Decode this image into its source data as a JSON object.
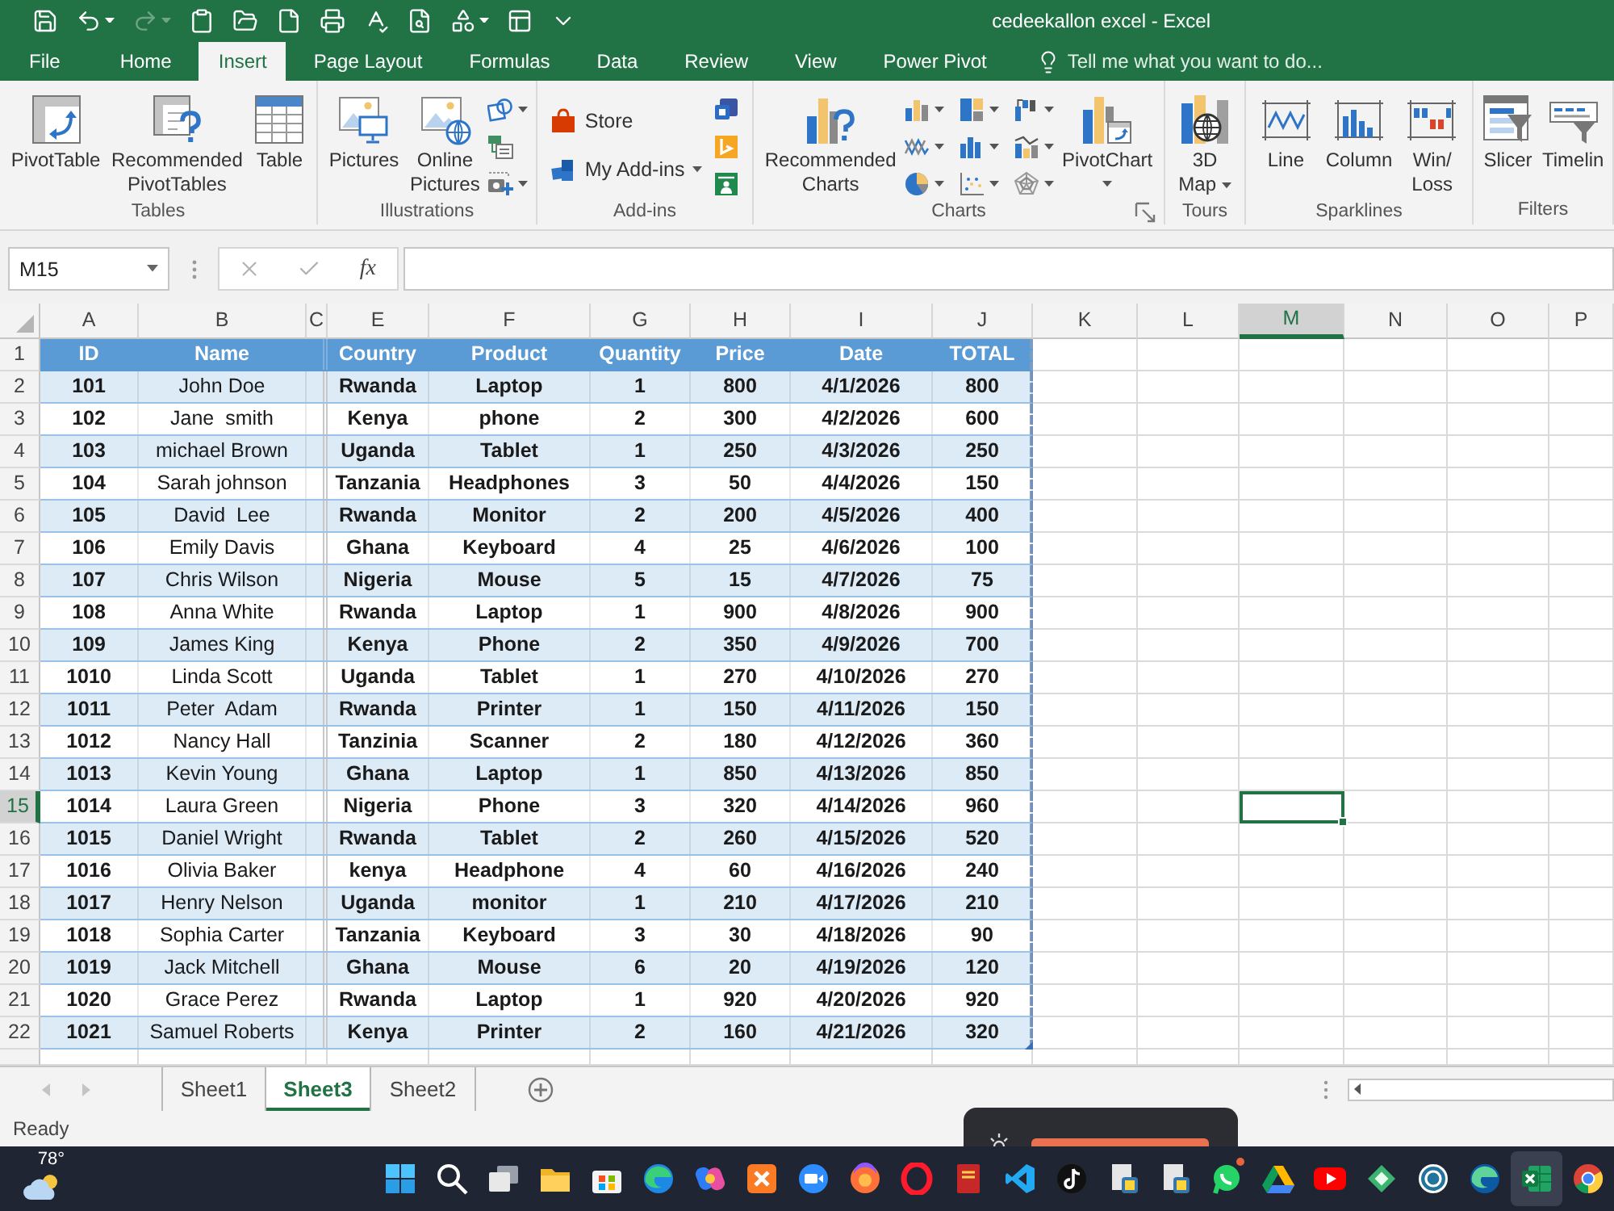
{
  "title_bar": {
    "title": "cedeekallon excel - Excel"
  },
  "quick_access": [
    {
      "disabled": false
    },
    {
      "disabled": false
    },
    {
      "disabled": true
    },
    {
      "disabled": false
    },
    {
      "disabled": false
    },
    {
      "disabled": false
    },
    {
      "disabled": false
    },
    {
      "disabled": false
    },
    {
      "disabled": false
    },
    {
      "disabled": false
    },
    {
      "disabled": false
    },
    {
      "disabled": false
    }
  ],
  "ribbon_tabs": [
    {
      "label": "File",
      "selected": false
    },
    {
      "label": "Home",
      "selected": false
    },
    {
      "label": "Insert",
      "selected": true
    },
    {
      "label": "Page Layout",
      "selected": false
    },
    {
      "label": "Formulas",
      "selected": false
    },
    {
      "label": "Data",
      "selected": false
    },
    {
      "label": "Review",
      "selected": false
    },
    {
      "label": "View",
      "selected": false
    },
    {
      "label": "Power Pivot",
      "selected": false
    }
  ],
  "tell_me": {
    "placeholder": "Tell me what you want to do..."
  },
  "ribbon_groups": [
    {
      "label": "Tables",
      "commands": [
        {
          "label": "PivotTable",
          "kind": "large",
          "dropdown": false
        },
        {
          "label": "Recommended\nPivotTables",
          "kind": "large",
          "dropdown": false
        },
        {
          "label": "Table",
          "kind": "large",
          "dropdown": false
        }
      ]
    },
    {
      "label": "Illustrations",
      "commands": [
        {
          "label": "Pictures",
          "kind": "large",
          "dropdown": false
        },
        {
          "label": "Online\nPictures",
          "kind": "large",
          "dropdown": false
        }
      ]
    },
    {
      "label": "Add-ins",
      "commands": [
        {
          "label": "Store",
          "kind": "small",
          "dropdown": false
        },
        {
          "label": "My Add-ins",
          "kind": "small",
          "dropdown": true
        }
      ]
    },
    {
      "label": "Charts",
      "commands": [
        {
          "label": "Recommended\nCharts",
          "kind": "large",
          "dropdown": false
        },
        {
          "label": "PivotChart",
          "kind": "large",
          "dropdown": true
        }
      ]
    },
    {
      "label": "Tours",
      "commands": [
        {
          "label": "3D\nMap",
          "kind": "large",
          "dropdown": true
        }
      ]
    },
    {
      "label": "Sparklines",
      "commands": [
        {
          "label": "Line",
          "kind": "large",
          "dropdown": false
        },
        {
          "label": "Column",
          "kind": "large",
          "dropdown": false
        },
        {
          "label": "Win/\nLoss",
          "kind": "large",
          "dropdown": false
        }
      ]
    },
    {
      "label": "Filters",
      "commands": [
        {
          "label": "Slicer",
          "kind": "large",
          "dropdown": false
        },
        {
          "label": "Timelin",
          "kind": "large",
          "dropdown": false
        }
      ]
    }
  ],
  "formula_bar": {
    "name_box": "M15",
    "function_button": "fx"
  },
  "column_headers": [
    {
      "label": "A",
      "selected": false
    },
    {
      "label": "B",
      "selected": false
    },
    {
      "label": "C",
      "selected": false
    },
    {
      "label": "E",
      "selected": false
    },
    {
      "label": "F",
      "selected": false
    },
    {
      "label": "G",
      "selected": false
    },
    {
      "label": "H",
      "selected": false
    },
    {
      "label": "I",
      "selected": false
    },
    {
      "label": "J",
      "selected": false
    },
    {
      "label": "K",
      "selected": false
    },
    {
      "label": "L",
      "selected": false
    },
    {
      "label": "M",
      "selected": true
    },
    {
      "label": "N",
      "selected": false
    },
    {
      "label": "O",
      "selected": false
    },
    {
      "label": "P",
      "selected": false
    }
  ],
  "row_headers": [
    {
      "label": "1",
      "selected": false
    },
    {
      "label": "2",
      "selected": false
    },
    {
      "label": "3",
      "selected": false
    },
    {
      "label": "4",
      "selected": false
    },
    {
      "label": "5",
      "selected": false
    },
    {
      "label": "6",
      "selected": false
    },
    {
      "label": "7",
      "selected": false
    },
    {
      "label": "8",
      "selected": false
    },
    {
      "label": "9",
      "selected": false
    },
    {
      "label": "10",
      "selected": false
    },
    {
      "label": "11",
      "selected": false
    },
    {
      "label": "12",
      "selected": false
    },
    {
      "label": "13",
      "selected": false
    },
    {
      "label": "14",
      "selected": false
    },
    {
      "label": "15",
      "selected": true
    },
    {
      "label": "16",
      "selected": false
    },
    {
      "label": "17",
      "selected": false
    },
    {
      "label": "18",
      "selected": false
    },
    {
      "label": "19",
      "selected": false
    },
    {
      "label": "20",
      "selected": false
    },
    {
      "label": "21",
      "selected": false
    },
    {
      "label": "22",
      "selected": false
    }
  ],
  "table": {
    "columns": [
      "ID",
      "Name",
      "Country",
      "Product",
      "Quantity",
      "Price",
      "Date",
      "TOTAL"
    ],
    "rows": [
      [
        "101",
        "John Doe",
        "Rwanda",
        "Laptop",
        "1",
        "800",
        "4/1/2026",
        "800"
      ],
      [
        "102",
        "Jane  smith",
        "Kenya",
        "phone",
        "2",
        "300",
        "4/2/2026",
        "600"
      ],
      [
        "103",
        "michael Brown",
        "Uganda",
        "Tablet",
        "1",
        "250",
        "4/3/2026",
        "250"
      ],
      [
        "104",
        "Sarah johnson",
        "Tanzania",
        "Headphones",
        "3",
        "50",
        "4/4/2026",
        "150"
      ],
      [
        "105",
        "David  Lee",
        "Rwanda",
        "Monitor",
        "2",
        "200",
        "4/5/2026",
        "400"
      ],
      [
        "106",
        "Emily Davis",
        "Ghana",
        "Keyboard",
        "4",
        "25",
        "4/6/2026",
        "100"
      ],
      [
        "107",
        "Chris Wilson",
        "Nigeria",
        "Mouse",
        "5",
        "15",
        "4/7/2026",
        "75"
      ],
      [
        "108",
        "Anna White",
        "Rwanda",
        "Laptop",
        "1",
        "900",
        "4/8/2026",
        "900"
      ],
      [
        "109",
        "James King",
        "Kenya",
        "Phone",
        "2",
        "350",
        "4/9/2026",
        "700"
      ],
      [
        "1010",
        "Linda Scott",
        "Uganda",
        "Tablet",
        "1",
        "270",
        "4/10/2026",
        "270"
      ],
      [
        "1011",
        "Peter  Adam",
        "Rwanda",
        "Printer",
        "1",
        "150",
        "4/11/2026",
        "150"
      ],
      [
        "1012",
        "Nancy Hall",
        "Tanzinia",
        "Scanner",
        "2",
        "180",
        "4/12/2026",
        "360"
      ],
      [
        "1013",
        "Kevin Young",
        "Ghana",
        "Laptop",
        "1",
        "850",
        "4/13/2026",
        "850"
      ],
      [
        "1014",
        "Laura Green",
        "Nigeria",
        "Phone",
        "3",
        "320",
        "4/14/2026",
        "960"
      ],
      [
        "1015",
        "Daniel Wright",
        "Rwanda",
        "Tablet",
        "2",
        "260",
        "4/15/2026",
        "520"
      ],
      [
        "1016",
        "Olivia Baker",
        "kenya",
        "Headphone",
        "4",
        "60",
        "4/16/2026",
        "240"
      ],
      [
        "1017",
        "Henry Nelson",
        "Uganda",
        "monitor",
        "1",
        "210",
        "4/17/2026",
        "210"
      ],
      [
        "1018",
        "Sophia Carter",
        "Tanzania",
        "Keyboard",
        "3",
        "30",
        "4/18/2026",
        "90"
      ],
      [
        "1019",
        "Jack Mitchell",
        "Ghana",
        "Mouse",
        "6",
        "20",
        "4/19/2026",
        "120"
      ],
      [
        "1020",
        "Grace Perez",
        "Rwanda",
        "Laptop",
        "1",
        "920",
        "4/20/2026",
        "920"
      ],
      [
        "1021",
        "Samuel Roberts",
        "Kenya",
        "Printer",
        "2",
        "160",
        "4/21/2026",
        "320"
      ]
    ]
  },
  "sheet_tabs": [
    {
      "label": "Sheet1",
      "selected": false
    },
    {
      "label": "Sheet3",
      "selected": true
    },
    {
      "label": "Sheet2",
      "selected": false
    }
  ],
  "status_bar": {
    "text": "Ready"
  },
  "taskbar": {
    "weather": "78°"
  }
}
